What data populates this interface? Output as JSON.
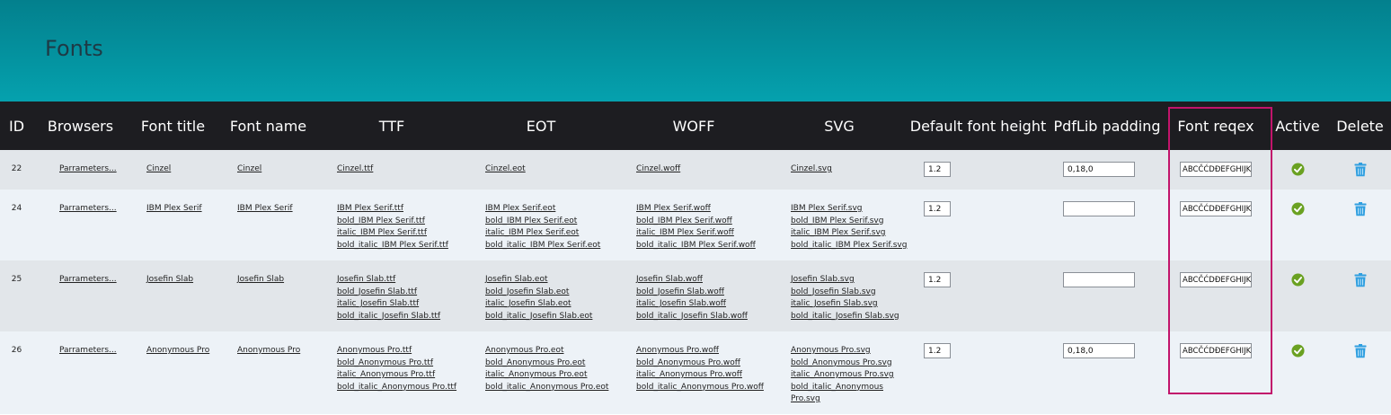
{
  "page": {
    "title": "Fonts"
  },
  "columns": [
    "ID",
    "Browsers",
    "Font title",
    "Font name",
    "TTF",
    "EOT",
    "WOFF",
    "SVG",
    "Default font height",
    "PdfLib padding",
    "Font reqex",
    "Active",
    "Delete"
  ],
  "rows": [
    {
      "id": "22",
      "browsers": "Parrameters...",
      "title": "Cinzel",
      "name": "Cinzel",
      "ttf": [
        "Cinzel.ttf"
      ],
      "eot": [
        "Cinzel.eot"
      ],
      "woff": [
        "Cinzel.woff"
      ],
      "svg": [
        "Cinzel.svg"
      ],
      "height": "1.2",
      "padding": "0,18,0",
      "regex": "ABCČĆDĐEFGHIJK",
      "active": "check-icon"
    },
    {
      "id": "24",
      "browsers": "Parrameters...",
      "title": "IBM Plex Serif",
      "name": "IBM Plex Serif",
      "ttf": [
        "IBM Plex Serif.ttf",
        "bold_IBM Plex Serif.ttf",
        "italic_IBM Plex Serif.ttf",
        "bold_italic_IBM Plex Serif.ttf"
      ],
      "eot": [
        "IBM Plex Serif.eot",
        "bold_IBM Plex Serif.eot",
        "italic_IBM Plex Serif.eot",
        "bold_italic_IBM Plex Serif.eot"
      ],
      "woff": [
        "IBM Plex Serif.woff",
        "bold_IBM Plex Serif.woff",
        "italic_IBM Plex Serif.woff",
        "bold_italic_IBM Plex Serif.woff"
      ],
      "svg": [
        "IBM Plex Serif.svg",
        "bold_IBM Plex Serif.svg",
        "italic_IBM Plex Serif.svg",
        "bold_italic_IBM Plex Serif.svg"
      ],
      "height": "1.2",
      "padding": "",
      "regex": "ABCČĆDĐEFGHIJK",
      "active": "check-icon"
    },
    {
      "id": "25",
      "browsers": "Parrameters...",
      "title": "Josefin Slab",
      "name": "Josefin Slab",
      "ttf": [
        "Josefin Slab.ttf",
        "bold_Josefin Slab.ttf",
        "italic_Josefin Slab.ttf",
        "bold_italic_Josefin Slab.ttf"
      ],
      "eot": [
        "Josefin Slab.eot",
        "bold_Josefin Slab.eot",
        "italic_Josefin Slab.eot",
        "bold_italic_Josefin Slab.eot"
      ],
      "woff": [
        "Josefin Slab.woff",
        "bold_Josefin Slab.woff",
        "italic_Josefin Slab.woff",
        "bold_italic_Josefin Slab.woff"
      ],
      "svg": [
        "Josefin Slab.svg",
        "bold_Josefin Slab.svg",
        "italic_Josefin Slab.svg",
        "bold_italic_Josefin Slab.svg"
      ],
      "height": "1.2",
      "padding": "",
      "regex": "ABCČĆDĐEFGHIJK",
      "active": "check-icon"
    },
    {
      "id": "26",
      "browsers": "Parrameters...",
      "title": "Anonymous Pro",
      "name": "Anonymous Pro",
      "ttf": [
        "Anonymous Pro.ttf",
        "bold_Anonymous Pro.ttf",
        "italic_Anonymous Pro.ttf",
        "bold_italic_Anonymous Pro.ttf"
      ],
      "eot": [
        "Anonymous Pro.eot",
        "bold_Anonymous Pro.eot",
        "italic_Anonymous Pro.eot",
        "bold_italic_Anonymous Pro.eot"
      ],
      "woff": [
        "Anonymous Pro.woff",
        "bold_Anonymous Pro.woff",
        "italic_Anonymous Pro.woff",
        "bold_italic_Anonymous Pro.woff"
      ],
      "svg": [
        "Anonymous Pro.svg",
        "bold_Anonymous Pro.svg",
        "italic_Anonymous Pro.svg",
        "bold_italic_Anonymous\nPro.svg"
      ],
      "height": "1.2",
      "padding": "0,18,0",
      "regex": "ABCČĆDĐEFGHIJK",
      "active": "check-icon"
    }
  ],
  "colors": {
    "header_top": "#03808d",
    "header_bottom": "#05a1ae",
    "table_header": "#1d1d21",
    "highlight": "#c2146b",
    "active_green": "#6aa121",
    "delete_blue": "#2f9fe0"
  }
}
